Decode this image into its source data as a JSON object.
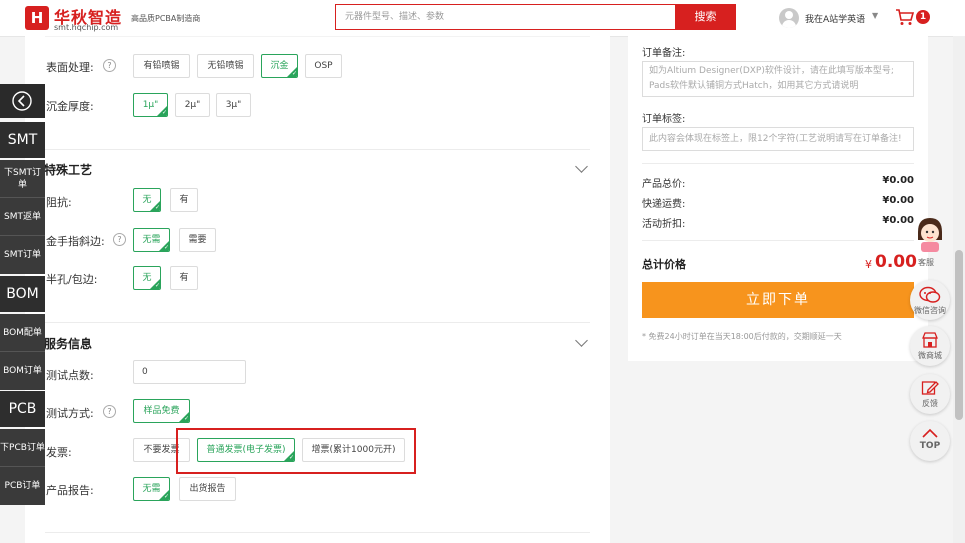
{
  "header": {
    "logo_mark": "H",
    "logo_name": "华秋智造",
    "logo_url": "smt.hqchip.com",
    "slogan": "高品质PCBA制造商",
    "search_placeholder": "元器件型号、描述、参数",
    "search_button": "搜索",
    "user_name": "我在A站学英语",
    "cart_count": "1"
  },
  "left_nav": [
    {
      "label": "SMT",
      "big": true
    },
    {
      "label": "下SMT订单",
      "big": false
    },
    {
      "label": "SMT返单",
      "big": false
    },
    {
      "label": "SMT订单",
      "big": false
    },
    {
      "label": "BOM",
      "big": true
    },
    {
      "label": "BOM配单",
      "big": false
    },
    {
      "label": "BOM订单",
      "big": false
    },
    {
      "label": "PCB",
      "big": true
    },
    {
      "label": "下PCB订单",
      "big": false
    },
    {
      "label": "PCB订单",
      "big": false
    }
  ],
  "form": {
    "surface_label": "表面处理:",
    "surface_options": [
      "有铅喷锡",
      "无铅喷锡",
      "沉金",
      "OSP"
    ],
    "surface_selected": "沉金",
    "gold_label": "沉金厚度:",
    "gold_options": [
      "1μ\"",
      "2μ\"",
      "3μ\""
    ],
    "gold_selected": "1μ\"",
    "special_title": "特殊工艺",
    "impedance_label": "阻抗:",
    "impedance_options": [
      "无",
      "有"
    ],
    "fingers_label": "金手指斜边:",
    "fingers_options": [
      "无需",
      "需要"
    ],
    "halfhole_label": "半孔/包边:",
    "halfhole_options": [
      "无",
      "有"
    ],
    "service_title": "服务信息",
    "testpoints_label": "测试点数:",
    "testpoints_value": "0",
    "testmethod_label": "测试方式:",
    "testmethod_option": "样品免费",
    "invoice_label": "发票:",
    "invoice_options": [
      "不要发票",
      "普通发票(电子发票)",
      "增票(累计1000元开)"
    ],
    "invoice_selected": "普通发票(电子发票)",
    "report_label": "产品报告:",
    "report_options": [
      "无需",
      "出货报告"
    ]
  },
  "summary": {
    "remark_label": "订单备注:",
    "remark_placeholder": "如为Altium Designer(DXP)软件设计，请在此填写版本型号; Pads软件默认铺铜方式Hatch，如用其它方式请说明",
    "tag_label": "订单标签:",
    "tag_placeholder": "此内容会体现在标签上，限12个字符(工艺说明请写在订单备注!",
    "total_product_label": "产品总价:",
    "total_product_value": "¥0.00",
    "shipping_label": "快递运费:",
    "shipping_value": "¥0.00",
    "discount_label": "活动折扣:",
    "discount_value": "¥0.00",
    "grand_total_label": "总计价格",
    "grand_total_currency": "¥",
    "grand_total_value": "0.00",
    "order_button": "立即下单",
    "note": "* 免费24小时订单在当天18:00后付款的，交期顺延一天"
  },
  "tools": [
    {
      "label": "客服",
      "icon": "customer-service-icon"
    },
    {
      "label": "微信咨询",
      "icon": "wechat-icon"
    },
    {
      "label": "微商城",
      "icon": "shop-icon"
    },
    {
      "label": "反馈",
      "icon": "edit-icon"
    },
    {
      "label": "TOP",
      "icon": "arrow-up-icon"
    }
  ],
  "colors": {
    "brand_red": "#d7201f",
    "selected_green": "#2aa45b",
    "order_orange": "#f7941d"
  }
}
